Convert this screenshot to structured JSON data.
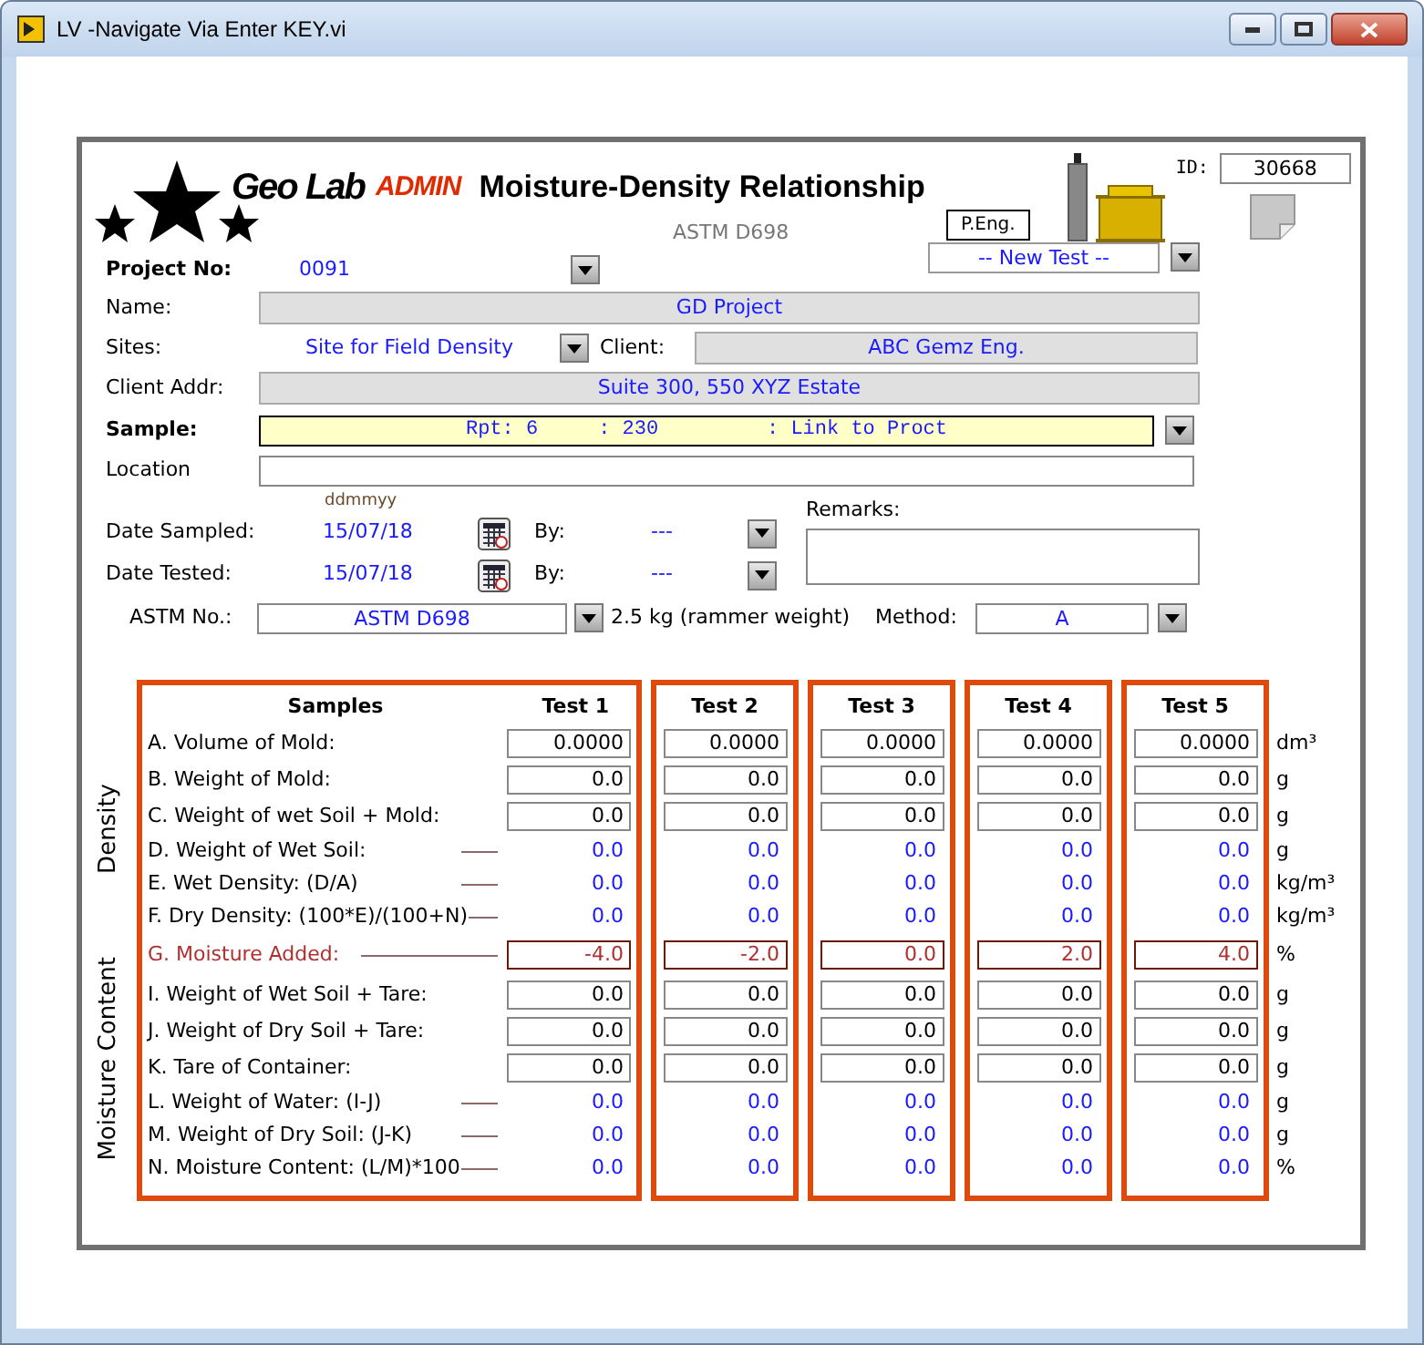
{
  "window": {
    "title": "LV -Navigate Via Enter KEY.vi"
  },
  "header": {
    "brand": "Geo Lab",
    "role": "ADMIN",
    "title": "Moisture-Density Relationship",
    "standard": "ASTM D698",
    "badge": "P.Eng.",
    "id_label": "ID:",
    "id_value": "30668",
    "test_select": "-- New Test --"
  },
  "form": {
    "project_no": {
      "label": "Project No:",
      "value": "0091"
    },
    "name": {
      "label": "Name:",
      "value": "GD Project"
    },
    "sites": {
      "label": "Sites:",
      "value": "Site for Field Density"
    },
    "client": {
      "label": "Client:",
      "value": "ABC Gemz Eng."
    },
    "client_addr": {
      "label": "Client Addr:",
      "value": "Suite 300, 550 XYZ Estate"
    },
    "sample": {
      "label": "Sample:",
      "value": "Rpt: 6     : 230         : Link to Proct"
    },
    "location": {
      "label": "Location"
    },
    "date_hint": "ddmmyy",
    "dates": [
      {
        "label": "Date Sampled:",
        "value": "15/07/18",
        "by_label": "By:",
        "by_value": "---"
      },
      {
        "label": "Date Tested:",
        "value": "15/07/18",
        "by_label": "By:",
        "by_value": "---"
      }
    ],
    "remarks": {
      "label": "Remarks:"
    },
    "astm": {
      "label": "ASTM No.:",
      "value": "ASTM D698"
    },
    "rammer": "2.5 kg (rammer weight)",
    "method": {
      "label": "Method:",
      "value": "A"
    }
  },
  "table": {
    "samples_heading": "Samples",
    "tests": [
      "Test 1",
      "Test 2",
      "Test 3",
      "Test 4",
      "Test 5"
    ],
    "groups": [
      {
        "label": "Density",
        "rows": [
          {
            "label": "A. Volume of Mold:",
            "kind": "input",
            "unit": "dm³",
            "values": [
              "0.0000",
              "0.0000",
              "0.0000",
              "0.0000",
              "0.0000"
            ]
          },
          {
            "label": "B. Weight of Mold:",
            "kind": "input",
            "unit": "g",
            "values": [
              "0.0",
              "0.0",
              "0.0",
              "0.0",
              "0.0"
            ]
          },
          {
            "label": "C. Weight of wet Soil + Mold:",
            "kind": "input",
            "unit": "g",
            "values": [
              "0.0",
              "0.0",
              "0.0",
              "0.0",
              "0.0"
            ]
          },
          {
            "label": "D. Weight of Wet Soil:",
            "kind": "computed",
            "unit": "g",
            "values": [
              "0.0",
              "0.0",
              "0.0",
              "0.0",
              "0.0"
            ]
          },
          {
            "label": "E. Wet Density: (D/A)",
            "kind": "computed",
            "unit": "kg/m³",
            "values": [
              "0.0",
              "0.0",
              "0.0",
              "0.0",
              "0.0"
            ]
          },
          {
            "label": "F. Dry Density: (100*E)/(100+N)",
            "kind": "computed",
            "unit": "kg/m³",
            "values": [
              "0.0",
              "0.0",
              "0.0",
              "0.0",
              "0.0"
            ]
          }
        ]
      },
      {
        "label": "Moisture Content",
        "rows": [
          {
            "label": "G. Moisture Added:",
            "kind": "moisture",
            "unit": "%",
            "values": [
              "-4.0",
              "-2.0",
              "0.0",
              "2.0",
              "4.0"
            ]
          },
          {
            "label": "I. Weight of Wet Soil + Tare:",
            "kind": "input",
            "unit": "g",
            "values": [
              "0.0",
              "0.0",
              "0.0",
              "0.0",
              "0.0"
            ]
          },
          {
            "label": "J. Weight of Dry Soil + Tare:",
            "kind": "input",
            "unit": "g",
            "values": [
              "0.0",
              "0.0",
              "0.0",
              "0.0",
              "0.0"
            ]
          },
          {
            "label": "K. Tare of Container:",
            "kind": "input",
            "unit": "g",
            "values": [
              "0.0",
              "0.0",
              "0.0",
              "0.0",
              "0.0"
            ]
          },
          {
            "label": "L. Weight of Water: (I-J)",
            "kind": "computed",
            "unit": "g",
            "values": [
              "0.0",
              "0.0",
              "0.0",
              "0.0",
              "0.0"
            ]
          },
          {
            "label": "M. Weight of Dry Soil: (J-K)",
            "kind": "computed",
            "unit": "g",
            "values": [
              "0.0",
              "0.0",
              "0.0",
              "0.0",
              "0.0"
            ]
          },
          {
            "label": "N. Moisture Content: (L/M)*100",
            "kind": "computed",
            "unit": "%",
            "values": [
              "0.0",
              "0.0",
              "0.0",
              "0.0",
              "0.0"
            ]
          }
        ]
      }
    ]
  }
}
